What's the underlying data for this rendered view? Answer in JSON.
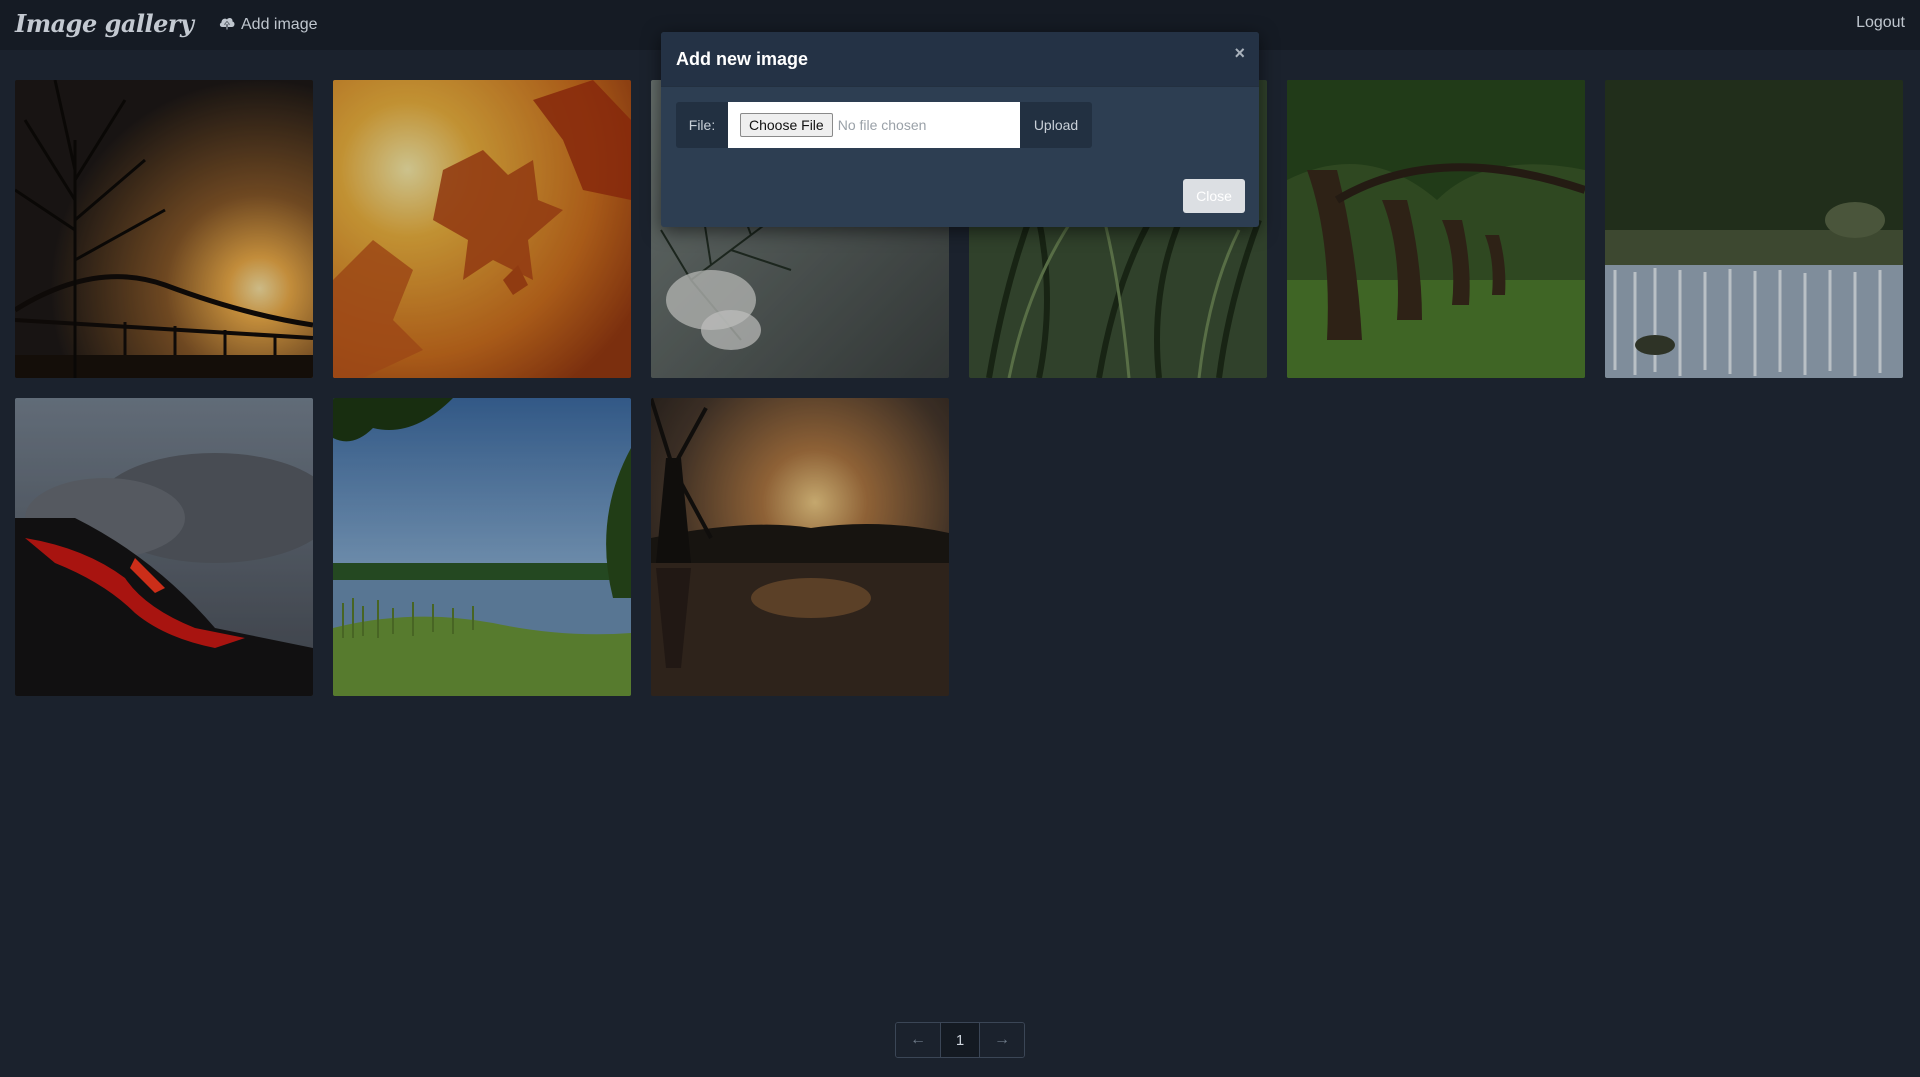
{
  "navbar": {
    "brand": "Image gallery",
    "add_image_label": "Add image",
    "logout_label": "Logout"
  },
  "gallery": {
    "images": [
      {
        "subject": "bridge at sunset"
      },
      {
        "subject": "autumn maple leaves"
      },
      {
        "subject": "pine branches"
      },
      {
        "subject": "green grass blades"
      },
      {
        "subject": "oak tree alley"
      },
      {
        "subject": "waterfall in forest"
      },
      {
        "subject": "lava and smoke"
      },
      {
        "subject": "lake with reeds"
      },
      {
        "subject": "windmill at sunset"
      }
    ]
  },
  "pagination": {
    "prev_label": "←",
    "current_page": "1",
    "next_label": "→"
  },
  "modal": {
    "title": "Add new image",
    "close_x": "×",
    "file_label": "File:",
    "choose_file_label": "Choose File",
    "no_file_text": "No file chosen",
    "upload_label": "Upload",
    "close_label": "Close"
  },
  "colors": {
    "background": "#1b222d",
    "navbar": "#151b24",
    "modal_body": "#2d3e52",
    "modal_header": "#243245"
  }
}
